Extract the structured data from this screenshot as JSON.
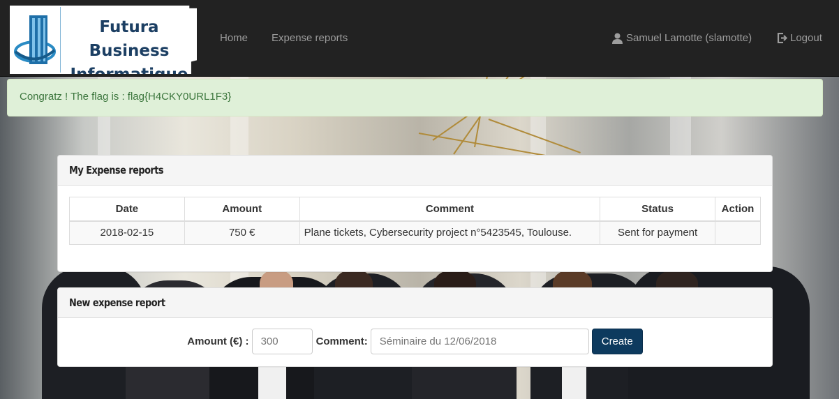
{
  "brand": {
    "name_line1": "Futura Business",
    "name_line2": "Informatique"
  },
  "nav": {
    "home": "Home",
    "expense_reports": "Expense reports",
    "user": "Samuel Lamotte (slamotte)",
    "logout": "Logout"
  },
  "alert": {
    "message": "Congratz ! The flag is : flag{H4CKY0URL1F3}"
  },
  "reports_panel": {
    "title": "My Expense reports",
    "columns": [
      "Date",
      "Amount",
      "Comment",
      "Status",
      "Action"
    ],
    "rows": [
      {
        "date": "2018-02-15",
        "amount": "750 €",
        "comment": "Plane tickets, Cybersecurity project n°5423545, Toulouse.",
        "status": "Sent for payment",
        "action": ""
      }
    ]
  },
  "new_report_panel": {
    "title": "New expense report",
    "amount_label": "Amount (€) :",
    "amount_placeholder": "300",
    "comment_label": "Comment:",
    "comment_placeholder": "Séminaire du 12/06/2018",
    "create_label": "Create"
  },
  "icons": {
    "user": "user-icon",
    "logout": "logout-icon"
  }
}
